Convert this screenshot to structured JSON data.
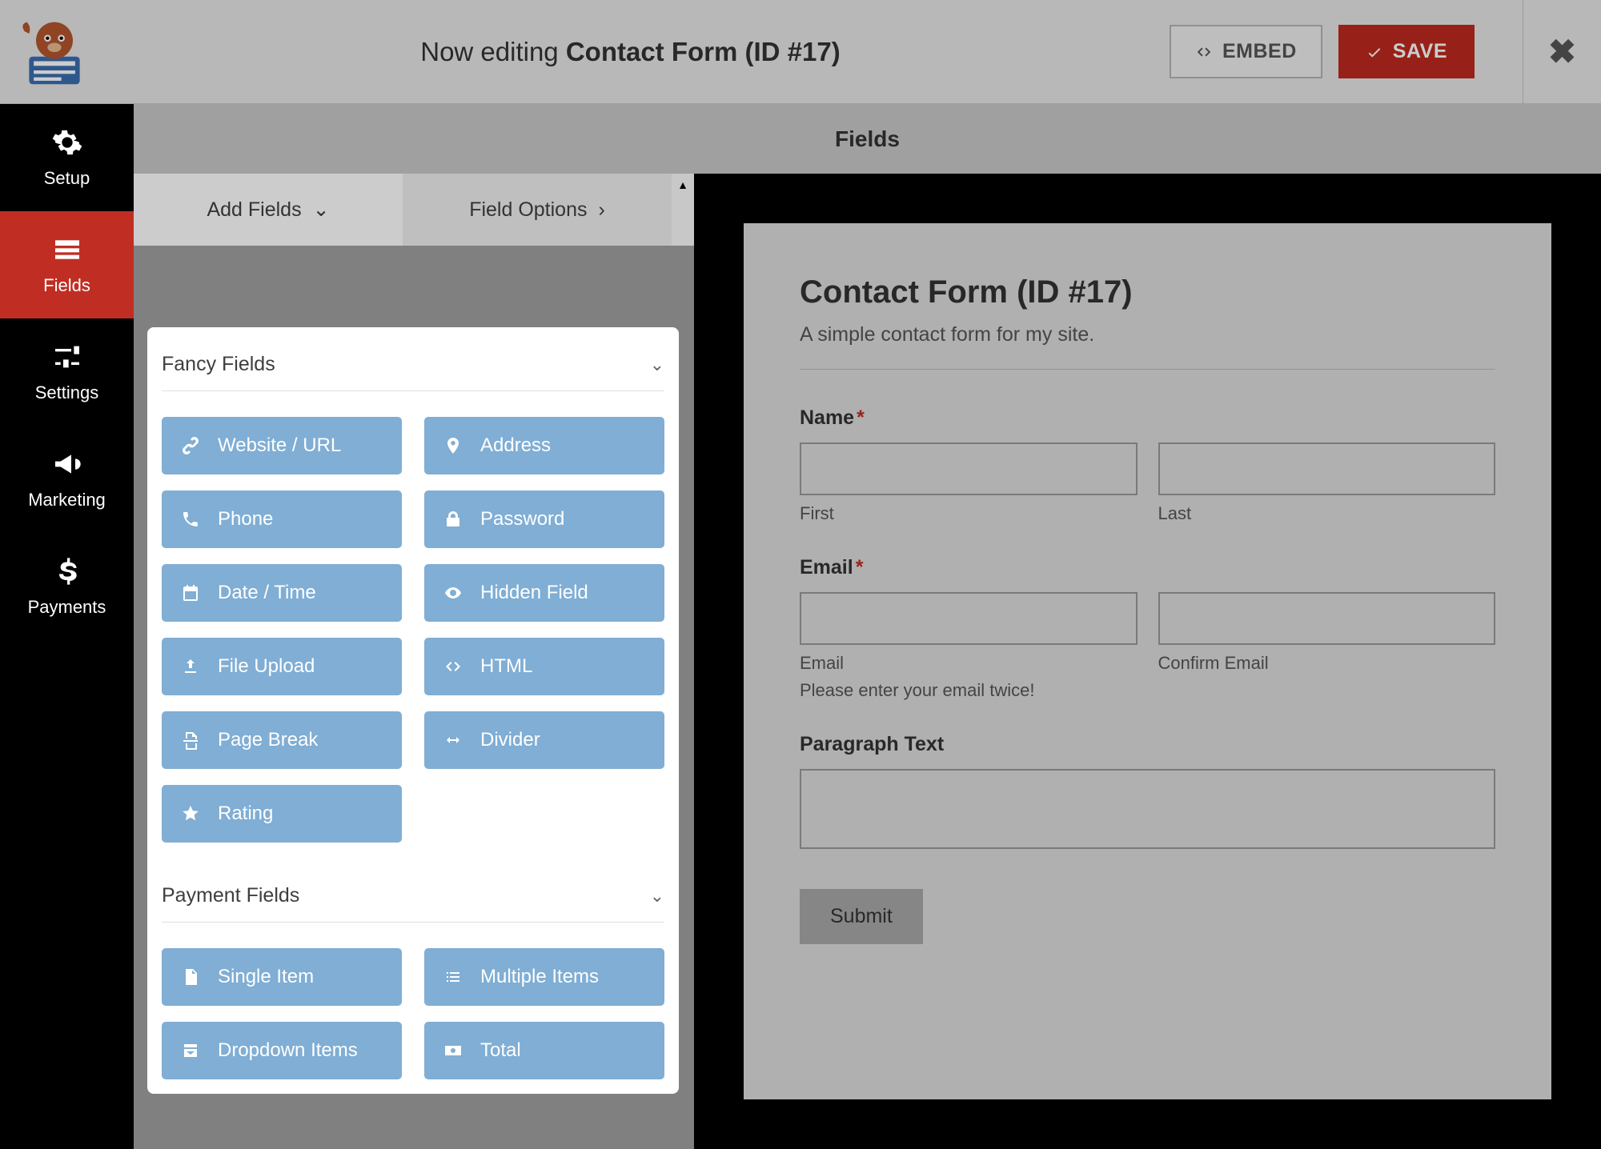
{
  "header": {
    "editing_prefix": "Now editing ",
    "editing_title": "Contact Form (ID #17)",
    "embed_label": "EMBED",
    "save_label": "SAVE"
  },
  "sidebar": {
    "items": [
      {
        "label": "Setup",
        "icon": "gear"
      },
      {
        "label": "Fields",
        "icon": "form"
      },
      {
        "label": "Settings",
        "icon": "sliders"
      },
      {
        "label": "Marketing",
        "icon": "bullhorn"
      },
      {
        "label": "Payments",
        "icon": "dollar"
      }
    ]
  },
  "section_title": "Fields",
  "tabs": {
    "add": "Add Fields",
    "options": "Field Options"
  },
  "groups": {
    "fancy": {
      "title": "Fancy Fields",
      "fields": [
        {
          "label": "Website / URL",
          "icon": "link"
        },
        {
          "label": "Address",
          "icon": "pin"
        },
        {
          "label": "Phone",
          "icon": "phone"
        },
        {
          "label": "Password",
          "icon": "lock"
        },
        {
          "label": "Date / Time",
          "icon": "calendar"
        },
        {
          "label": "Hidden Field",
          "icon": "eyeoff"
        },
        {
          "label": "File Upload",
          "icon": "upload"
        },
        {
          "label": "HTML",
          "icon": "code"
        },
        {
          "label": "Page Break",
          "icon": "pagebreak"
        },
        {
          "label": "Divider",
          "icon": "arrows"
        },
        {
          "label": "Rating",
          "icon": "star"
        }
      ]
    },
    "payment": {
      "title": "Payment Fields",
      "fields": [
        {
          "label": "Single Item",
          "icon": "file"
        },
        {
          "label": "Multiple Items",
          "icon": "list"
        },
        {
          "label": "Dropdown Items",
          "icon": "dropdown"
        },
        {
          "label": "Total",
          "icon": "money"
        }
      ]
    }
  },
  "preview": {
    "title": "Contact Form (ID #17)",
    "description": "A simple contact form for my site.",
    "name_label": "Name",
    "first_sub": "First",
    "last_sub": "Last",
    "email_label": "Email",
    "email_sub": "Email",
    "confirm_sub": "Confirm Email",
    "email_help": "Please enter your email twice!",
    "paragraph_label": "Paragraph Text",
    "submit_label": "Submit"
  }
}
